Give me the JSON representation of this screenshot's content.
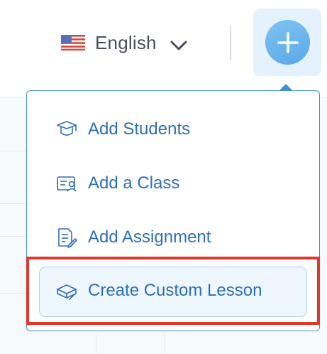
{
  "header": {
    "language": {
      "label": "English",
      "flag": "us-flag-icon"
    },
    "add_button": {
      "icon": "plus-icon"
    }
  },
  "menu": {
    "items": [
      {
        "label": "Add Students",
        "icon": "graduation-cap-icon"
      },
      {
        "label": "Add a Class",
        "icon": "class-card-icon"
      },
      {
        "label": "Add Assignment",
        "icon": "assignment-doc-icon"
      },
      {
        "label": "Create Custom Lesson",
        "icon": "lesson-book-icon",
        "highlighted": true
      }
    ]
  },
  "colors": {
    "menu_text": "#2f6fb7",
    "menu_border": "#3f92d4",
    "highlight_outline": "#e2362c",
    "add_button": "#6cb6ef"
  }
}
